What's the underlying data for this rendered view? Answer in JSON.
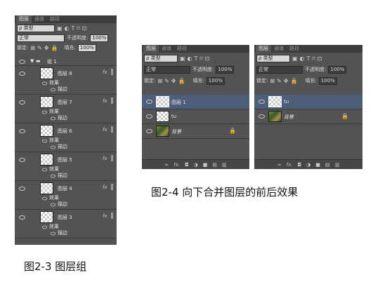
{
  "left_panel": {
    "tabs": [
      "图层",
      "通道",
      "路径"
    ],
    "filter_label": "ρ 类型",
    "blend_mode": "正常",
    "opacity_label": "不透明度:",
    "opacity_value": "100%",
    "lock_label": "锁定:",
    "fill_label": "填充:",
    "fill_value": "100%",
    "group_name": "组 1",
    "layers": [
      {
        "name": "图层 8",
        "effects": "效果",
        "stroke": "描边",
        "fx": "fx"
      },
      {
        "name": "图层 7",
        "effects": "效果",
        "stroke": "描边",
        "fx": "fx"
      },
      {
        "name": "图层 6",
        "effects": "效果",
        "stroke": "描边",
        "fx": "fx"
      },
      {
        "name": "图层 5",
        "effects": "效果",
        "stroke": "描边",
        "fx": "fx"
      },
      {
        "name": "图层 4",
        "effects": "效果",
        "stroke": "描边",
        "fx": "fx"
      },
      {
        "name": "图层 3",
        "effects": "效果",
        "stroke": "描边",
        "fx": "fx"
      }
    ]
  },
  "mid_panel": {
    "tabs": [
      "图层",
      "通道",
      "路径"
    ],
    "filter_label": "ρ 类型",
    "blend_mode": "正常",
    "opacity_label": "不透明度:",
    "opacity_value": "100%",
    "lock_label": "锁定:",
    "fill_label": "填充:",
    "fill_value": "100%",
    "layers": [
      {
        "name": "图层 1"
      },
      {
        "name": "tu"
      },
      {
        "name": "背景"
      }
    ],
    "bottom_fx": "fx."
  },
  "right_panel": {
    "tabs": [
      "图层",
      "通道",
      "路径"
    ],
    "filter_label": "ρ 类型",
    "blend_mode": "正常",
    "opacity_label": "不透明度:",
    "opacity_value": "100%",
    "lock_label": "锁定:",
    "fill_label": "填充:",
    "fill_value": "100%",
    "layers": [
      {
        "name": "tu"
      },
      {
        "name": "背景"
      }
    ],
    "bottom_fx": "fx."
  },
  "captions": {
    "fig23": "图2-3 图层组",
    "fig24": "图2-4 向下合并图层的前后效果"
  },
  "icons": [
    "eye-icon",
    "folder-icon",
    "lock-icon",
    "link-icon",
    "fx-icon",
    "mask-icon",
    "adjustment-icon",
    "new-group-icon",
    "new-layer-icon",
    "trash-icon"
  ]
}
